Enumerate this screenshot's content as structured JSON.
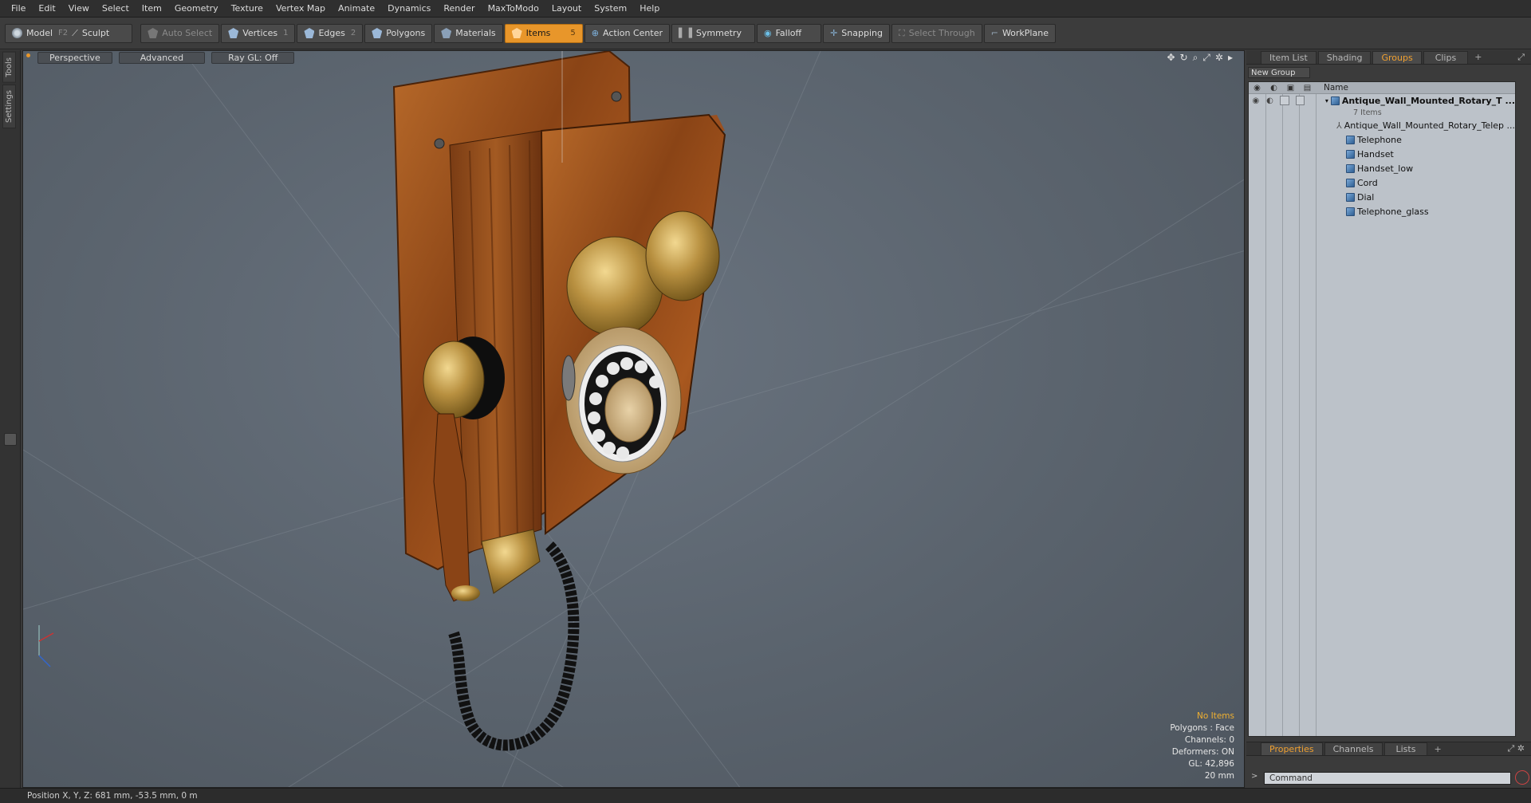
{
  "menu": [
    "File",
    "Edit",
    "View",
    "Select",
    "Item",
    "Geometry",
    "Texture",
    "Vertex Map",
    "Animate",
    "Dynamics",
    "Render",
    "MaxToModo",
    "Layout",
    "System",
    "Help"
  ],
  "toolbar": {
    "model": "Model",
    "model_key": "F2",
    "sculpt": "Sculpt",
    "auto_select": "Auto Select",
    "vertices": "Vertices",
    "vertices_key": "1",
    "edges": "Edges",
    "edges_key": "2",
    "polygons": "Polygons",
    "materials": "Materials",
    "items": "Items",
    "items_key": "5",
    "action_center": "Action Center",
    "symmetry": "Symmetry",
    "falloff": "Falloff",
    "snapping": "Snapping",
    "select_through": "Select Through",
    "workplane": "WorkPlane"
  },
  "left_tabs": [
    "Tools",
    "Settings"
  ],
  "viewport": {
    "view": "Perspective",
    "advanced": "Advanced",
    "raygl": "Ray GL: Off",
    "stats": {
      "items": "No Items",
      "polygons": "Polygons : Face",
      "channels": "Channels: 0",
      "deformers": "Deformers: ON",
      "gl": "GL: 42,896",
      "scale": "20 mm"
    }
  },
  "status": "Position X, Y, Z:  681 mm, -53.5 mm, 0 m",
  "panel": {
    "tabs": [
      "Item List",
      "Shading",
      "Groups",
      "Clips"
    ],
    "active_tab": "Groups",
    "new_group": "New Group",
    "name_header": "Name",
    "group_name": "Antique_Wall_Mounted_Rotary_T ...",
    "group_count": "7 Items",
    "items": [
      "Antique_Wall_Mounted_Rotary_Telep ...",
      "Telephone",
      "Handset",
      "Handset_low",
      "Cord",
      "Dial",
      "Telephone_glass"
    ],
    "bottom_tabs": [
      "Properties",
      "Channels",
      "Lists"
    ],
    "active_bottom_tab": "Properties",
    "command_placeholder": "Command"
  }
}
